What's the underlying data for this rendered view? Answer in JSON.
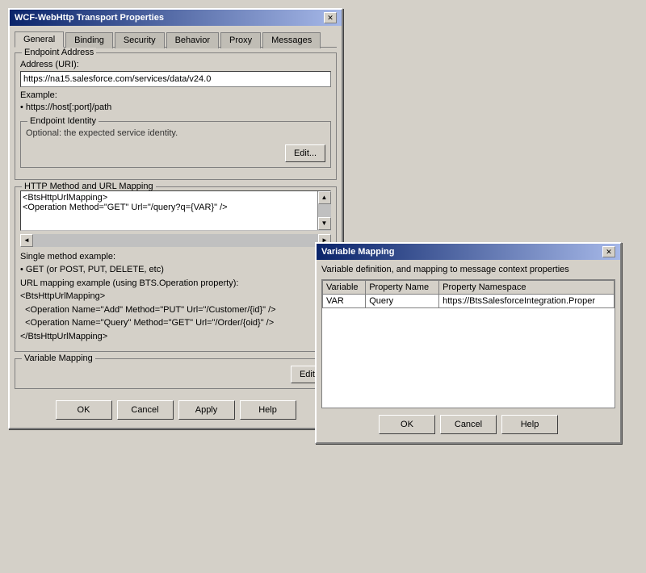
{
  "main_dialog": {
    "title": "WCF-WebHttp Transport Properties",
    "tabs": [
      {
        "label": "General",
        "active": true
      },
      {
        "label": "Binding",
        "active": false
      },
      {
        "label": "Security",
        "active": false
      },
      {
        "label": "Behavior",
        "active": false
      },
      {
        "label": "Proxy",
        "active": false
      },
      {
        "label": "Messages",
        "active": false
      }
    ],
    "endpoint_address": {
      "legend": "Endpoint Address",
      "address_label": "Address (URI):",
      "address_value": "https://na15.salesforce.com/services/data/v24.0",
      "example_label": "Example:",
      "example_value": "• https://host[:port]/path"
    },
    "endpoint_identity": {
      "legend": "Endpoint Identity",
      "description": "Optional: the expected service identity.",
      "edit_label": "Edit..."
    },
    "http_method": {
      "legend": "HTTP Method and URL Mapping",
      "url_mapping_line1": "<BtsHttpUrlMapping>",
      "url_mapping_line2": "<Operation Method=\"GET\" Url=\"/query?q={VAR}\" />",
      "single_method_label": "Single method example:",
      "single_method_text": "• GET (or POST, PUT, DELETE, etc)",
      "url_mapping_example_label": "URL mapping example (using BTS.Operation property):",
      "example_lines": [
        "<BtsHttpUrlMapping>",
        "  <Operation Name=\"Add\" Method=\"PUT\" Url=\"/Customer/{id}\" />",
        "  <Operation Name=\"Query\" Method=\"GET\" Url=\"/Order/{oid}\" />",
        "</BtsHttpUrlMapping>"
      ]
    },
    "variable_mapping": {
      "legend": "Variable Mapping",
      "edit_label": "Edit..."
    },
    "buttons": {
      "ok": "OK",
      "cancel": "Cancel",
      "apply": "Apply",
      "help": "Help"
    }
  },
  "var_dialog": {
    "title": "Variable Mapping",
    "description": "Variable definition, and mapping to message context properties",
    "table": {
      "headers": [
        "Variable",
        "Property Name",
        "Property Namespace"
      ],
      "rows": [
        [
          "VAR",
          "Query",
          "https://BtsSalesforceIntegration.Proper"
        ]
      ]
    },
    "buttons": {
      "ok": "OK",
      "cancel": "Cancel",
      "help": "Help"
    }
  }
}
